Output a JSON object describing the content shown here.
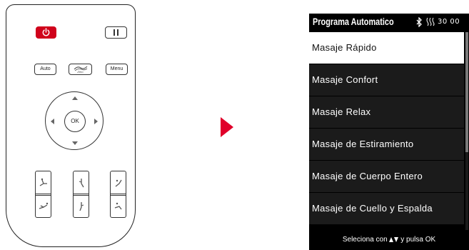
{
  "remote": {
    "buttons": {
      "auto_label": "Auto",
      "zero_label": "Zero",
      "menu_label": "Menu",
      "ok_label": "OK"
    },
    "colors": {
      "power": "#d0021b"
    }
  },
  "arrow_color": "#e0002a",
  "screen": {
    "title": "Programa Automatico",
    "timer": "30 00",
    "icons": [
      "bluetooth-icon",
      "heat-icon"
    ],
    "menu_items": [
      {
        "label": "Masaje Rápido",
        "selected": true
      },
      {
        "label": "Masaje Confort",
        "selected": false
      },
      {
        "label": "Masaje Relax",
        "selected": false
      },
      {
        "label": "Masaje de Estiramiento",
        "selected": false
      },
      {
        "label": "Masaje de Cuerpo Entero",
        "selected": false
      },
      {
        "label": "Masaje de Cuello y Espalda",
        "selected": false
      }
    ],
    "footer": {
      "prefix": "Seleciona con",
      "suffix": "y pulsa OK"
    }
  }
}
